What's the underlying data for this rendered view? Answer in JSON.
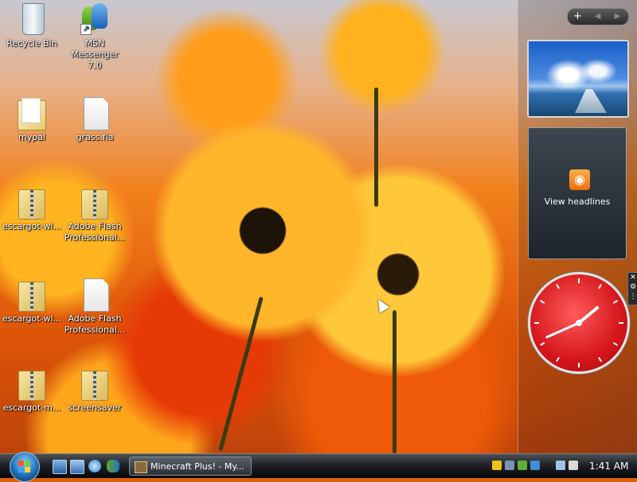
{
  "desktop": {
    "icons": {
      "recycle_bin": "Recycle Bin",
      "msn_messenger": "MSN Messenger 7.0",
      "mypal": "mypal",
      "grass_fla": "grass.fla",
      "escargot_1": "escargot-wl...",
      "adobe_flash_1": "Adobe Flash Professional...",
      "escargot_2": "escargot-wl...",
      "adobe_flash_2": "Adobe Flash Professional...",
      "escargot_3": "escargot-m...",
      "screensaver": "screensaver"
    }
  },
  "sidebar": {
    "controls": {
      "add": "+",
      "prev": "◀",
      "next": "▶"
    },
    "feed": {
      "label": "View headlines",
      "icon": "rss-icon"
    },
    "clock": {
      "hour": 1,
      "minute": 41
    }
  },
  "taskbar": {
    "window_title": "Minecraft Plus! - My...",
    "clock": "1:41 AM"
  },
  "colors": {
    "clock_face": "#d4161c",
    "rss_orange": "#e96f0b"
  }
}
